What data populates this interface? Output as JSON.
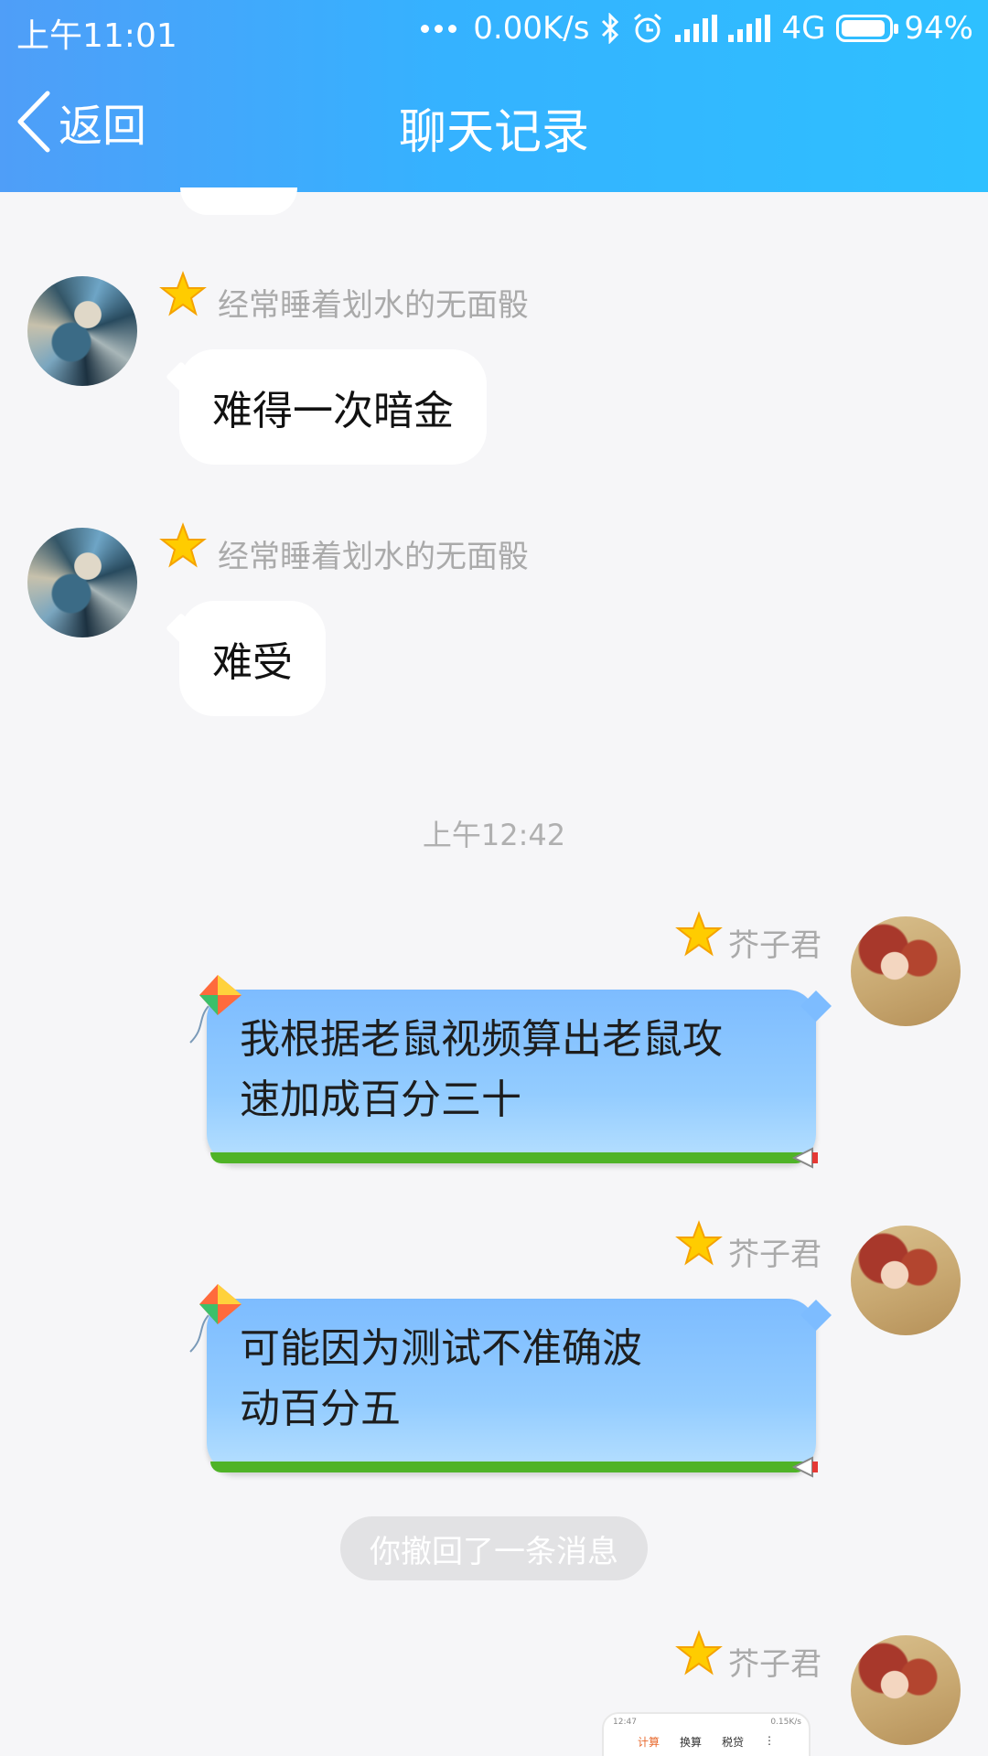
{
  "status_bar": {
    "time": "上午11:01",
    "speed": "0.00K/s",
    "network": "4G",
    "battery": "94%",
    "icons": [
      "more-dots-icon",
      "bluetooth-icon",
      "alarm-icon",
      "signal-icon",
      "signal-icon",
      "battery-icon"
    ]
  },
  "nav": {
    "back_label": "返回",
    "title": "聊天记录"
  },
  "messages": [
    {
      "side": "left",
      "sender": "经常睡着划水的无面骰",
      "text": "难得一次暗金"
    },
    {
      "side": "left",
      "sender": "经常睡着划水的无面骰",
      "text": "难受"
    },
    {
      "type": "time",
      "text": "上午12:42"
    },
    {
      "side": "right",
      "sender": "芥子君",
      "lines": [
        "我根据老鼠视频算出老鼠攻",
        "速加成百分三十"
      ]
    },
    {
      "side": "right",
      "sender": "芥子君",
      "lines": [
        "可能因为测试不准确波",
        "动百分五"
      ]
    },
    {
      "type": "system",
      "text": "你撤回了一条消息"
    },
    {
      "side": "right",
      "sender": "芥子君",
      "image": {
        "tabs": [
          "计算",
          "换算",
          "税贷"
        ],
        "time": "12:47",
        "speed": "0.15K/s"
      }
    }
  ],
  "colors": {
    "header_start": "#4f9ef8",
    "header_end": "#2ec0ff",
    "bubble_blue": "#8cc6ff",
    "background": "#f6f6f8",
    "sender_gray": "#aaaaaa"
  }
}
